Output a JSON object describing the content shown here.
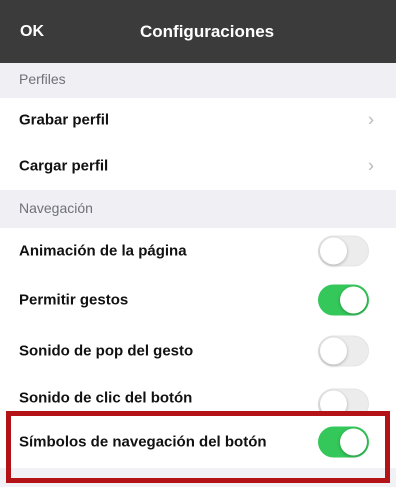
{
  "header": {
    "ok_label": "OK",
    "title": "Configuraciones"
  },
  "sections": {
    "perfiles": {
      "title": "Perfiles"
    },
    "navegacion": {
      "title": "Navegación"
    }
  },
  "rows": {
    "grabar_perfil": {
      "label": "Grabar perfil"
    },
    "cargar_perfil": {
      "label": "Cargar perfil"
    },
    "animacion": {
      "label": "Animación de la página",
      "enabled": false
    },
    "gestos": {
      "label": "Permitir gestos",
      "enabled": true
    },
    "sonido_pop": {
      "label": "Sonido de pop del gesto",
      "enabled": false
    },
    "sonido_clic": {
      "label": "Sonido de clic del botón",
      "enabled": false
    },
    "simbolos": {
      "label": "Símbolos de navegación del botón",
      "enabled": true
    }
  },
  "icons": {
    "disclosure": "chevron-right-icon"
  },
  "colors": {
    "header_bg": "#3b3b3b",
    "toggle_on": "#34c759",
    "highlight": "#b31217"
  }
}
